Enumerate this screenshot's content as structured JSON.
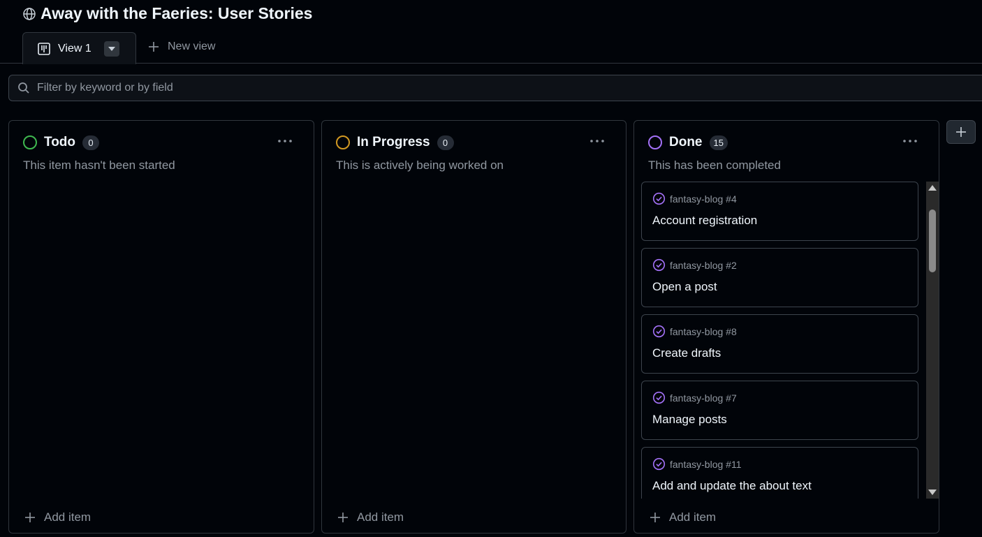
{
  "project": {
    "title": "Away with the Faeries: User Stories"
  },
  "tabs": {
    "active_label": "View 1",
    "new_view_label": "New view"
  },
  "filter": {
    "placeholder": "Filter by keyword or by field"
  },
  "columns": [
    {
      "name": "Todo",
      "count": "0",
      "description": "This item hasn't been started",
      "color": "#3fb950",
      "add_label": "Add item"
    },
    {
      "name": "In Progress",
      "count": "0",
      "description": "This is actively being worked on",
      "color": "#d29922",
      "add_label": "Add item"
    },
    {
      "name": "Done",
      "count": "15",
      "description": "This has been completed",
      "color": "#a371f7",
      "add_label": "Add item",
      "cards": [
        {
          "ref": "fantasy-blog #4",
          "title": "Account registration"
        },
        {
          "ref": "fantasy-blog #2",
          "title": "Open a post"
        },
        {
          "ref": "fantasy-blog #8",
          "title": "Create drafts"
        },
        {
          "ref": "fantasy-blog #7",
          "title": "Manage posts"
        },
        {
          "ref": "fantasy-blog #11",
          "title": "Add and update the about text"
        }
      ]
    }
  ],
  "colors": {
    "done_accent": "#a371f7",
    "background": "#010409",
    "border": "#30363d"
  },
  "icons": {
    "globe": "globe-icon",
    "board": "board-icon",
    "caret": "caret-down-icon",
    "plus": "plus-icon",
    "search": "search-icon",
    "more": "kebab-horizontal-icon",
    "closed": "issue-closed-icon"
  }
}
